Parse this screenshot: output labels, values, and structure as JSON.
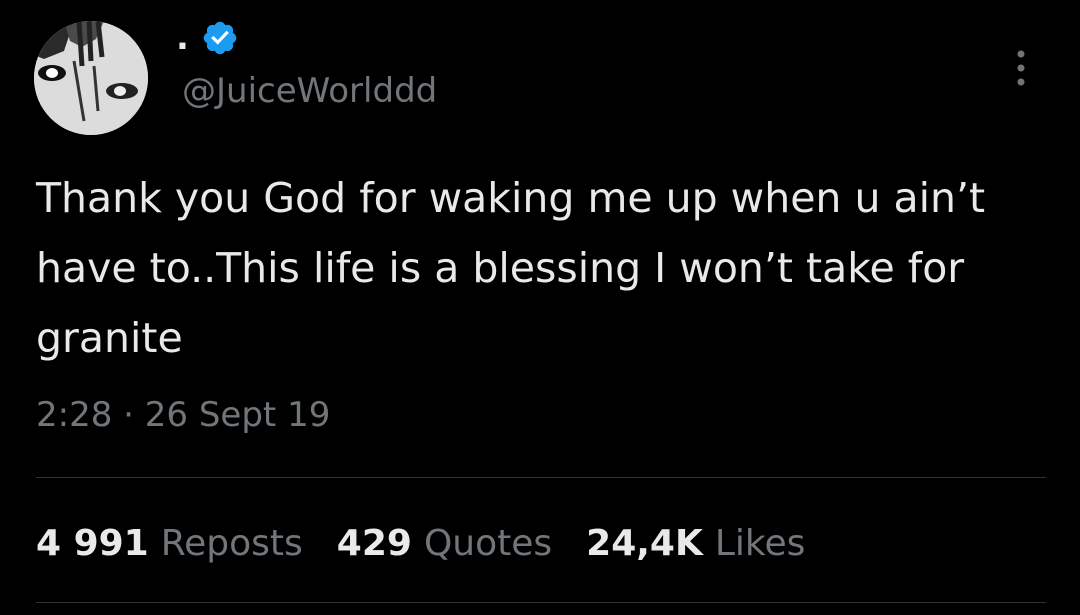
{
  "author": {
    "display_name": ".",
    "handle": "@JuiceWorlddd",
    "verified_badge_color": "#1d9bf0"
  },
  "tweet": {
    "text": "Thank you God for waking me up when u ain’t have to..This life is a blessing I won’t take for granite",
    "timestamp": "2:28 · 26 Sept 19"
  },
  "stats": {
    "reposts": {
      "count": "4 991",
      "label": "Reposts"
    },
    "quotes": {
      "count": "429",
      "label": "Quotes"
    },
    "likes": {
      "count": "24,4K",
      "label": "Likes"
    }
  },
  "icons": {
    "more": "more-vertical-icon",
    "verified": "verified-badge-icon"
  },
  "colors": {
    "background": "#000000",
    "primary_text": "#e7e9ea",
    "secondary_text": "#71767b",
    "divider": "#2f3336"
  }
}
